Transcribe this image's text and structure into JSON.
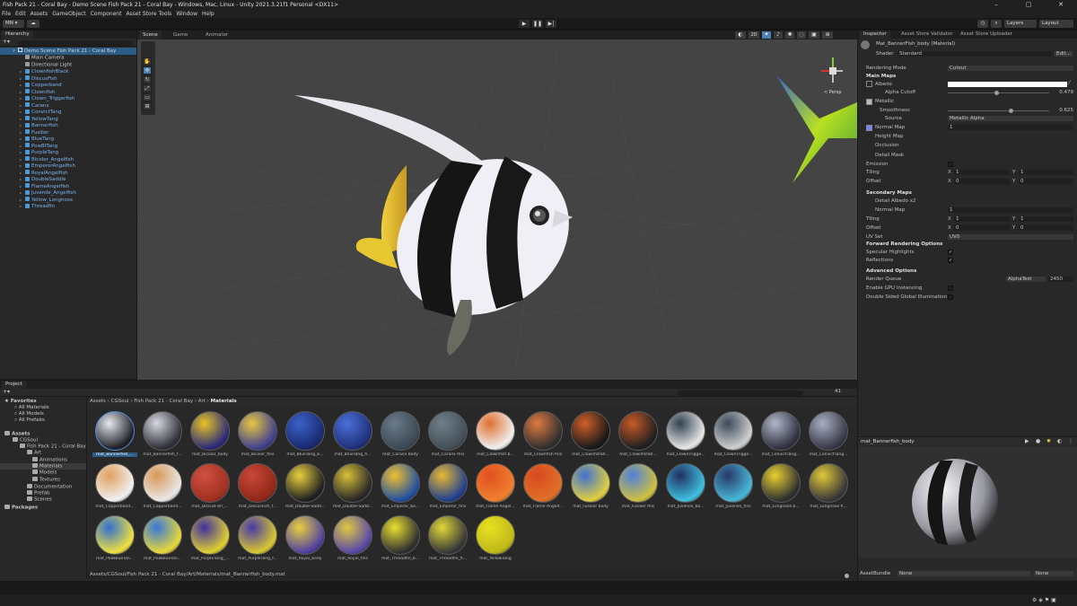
{
  "window": {
    "title": "Fish Pack 21 - Coral Bay - Demo Scene Fish Pack 21 - Coral Bay - Windows, Mac, Linux - Unity 2021.3.21f1 Personal <DX11>",
    "buttons": [
      "–",
      "▢",
      "✕"
    ]
  },
  "menu": [
    "File",
    "Edit",
    "Assets",
    "GameObject",
    "Component",
    "Asset Store Tools",
    "Window",
    "Help"
  ],
  "toolbar": {
    "account": "MN ▾",
    "layers": "Layers",
    "layout": "Layout"
  },
  "hierarchy": {
    "tab": "Hierarchy",
    "root": "Demo Scene Fish Pack 21 - Coral Bay",
    "items": [
      "Main Camera",
      "Directional Light",
      "ClownfishBlack",
      "DiscusFish",
      "Copperband",
      "Clownfish",
      "Clown_Triggerfish",
      "Caranx",
      "ConvictTang",
      "YellowTang",
      "Bannerfish",
      "Fusilier",
      "BlueTang",
      "PowBlTang",
      "PurpleTang",
      "Bicolor_Angelfish",
      "EmperorAngelfish",
      "RoyalAngelfish",
      "DoubleSaddle",
      "FlameAngelfish",
      "Juvenile_Angelfish",
      "Yellow_Longnose",
      "Threadfin"
    ]
  },
  "scene_tabs": [
    "Scene",
    "Game",
    "Animator"
  ],
  "scene_view": {
    "persp_label": "< Persp",
    "mode_2d": "2D"
  },
  "inspector": {
    "tabs": [
      "Inspector",
      "Asset Store Validator",
      "Asset Store Uploader"
    ],
    "material_name": "Mat_BannerFish_body (Material)",
    "shader_label": "Shader",
    "shader_value": "Standard",
    "edit_button": "Edit...",
    "rendering_mode_label": "Rendering Mode",
    "rendering_mode_value": "Cutout",
    "main_maps": "Main Maps",
    "albedo": "Albedo",
    "alpha_cutoff": "Alpha Cutoff",
    "alpha_cutoff_value": "0.479",
    "alpha_cutoff_level": 0.479,
    "metallic": "Metallic",
    "smoothness": "Smoothness",
    "smoothness_value": "0.625",
    "smoothness_level": 0.625,
    "source": "Source",
    "source_value": "Metallic Alpha",
    "normal_map": "Normal Map",
    "normal_map_value": "1",
    "height_map": "Height Map",
    "occlusion": "Occlusion",
    "detail_mask": "Detail Mask",
    "emission": "Emission",
    "tiling": "Tiling",
    "offset": "Offset",
    "tiling_x": "1",
    "tiling_y": "1",
    "offset_x": "0",
    "offset_y": "0",
    "secondary_maps": "Secondary Maps",
    "detail_albedo": "Detail Albedo x2",
    "normal_map2": "Normal Map",
    "normal_map2_value": "1",
    "tiling2_x": "1",
    "tiling2_y": "1",
    "offset2_x": "0",
    "offset2_y": "0",
    "uv_set": "UV Set",
    "uv_set_value": "UV0",
    "forward_options": "Forward Rendering Options",
    "specular_highlights": "Specular Highlights",
    "reflections": "Reflections",
    "advanced_options": "Advanced Options",
    "render_queue": "Render Queue",
    "render_queue_mode": "AlphaTest",
    "render_queue_value": "2450",
    "gpu_instancing": "Enable GPU Instancing",
    "double_sided_gi": "Double Sided Global Illumination",
    "preview_title": "mat_Bannerfish_body",
    "assetbundle_label": "AssetBundle",
    "assetbundle_value": "None",
    "assetbundle_variant": "None",
    "x_label": "X",
    "y_label": "Y"
  },
  "project": {
    "tab": "Project",
    "favorites": "Favorites",
    "fav_items": [
      "All Materials",
      "All Models",
      "All Prefabs"
    ],
    "assets": "Assets",
    "tree": [
      "CGSoul",
      "Fish Pack 21 - Coral Bay",
      "Art",
      "Animations",
      "Materials",
      "Models",
      "Textures",
      "Documentation",
      "Prefab",
      "Scenes"
    ],
    "packages": "Packages",
    "breadcrumb": [
      "Assets",
      "CGSoul",
      "Fish Pack 21 - Coral Bay",
      "Art",
      "Materials"
    ],
    "materials": [
      {
        "name": "mat_Bannerfish_...",
        "c1": "#e8e8f0",
        "c2": "#202028"
      },
      {
        "name": "mat_Bannerfish_f...",
        "c1": "#d8d8e0",
        "c2": "#303038"
      },
      {
        "name": "mat_Bicolor_body",
        "c1": "#e7c324",
        "c2": "#2a2a7a"
      },
      {
        "name": "mat_Bicolor_fins",
        "c1": "#e5c640",
        "c2": "#404090"
      },
      {
        "name": "mat_BlueTang_b...",
        "c1": "#3a62c8",
        "c2": "#1a2a70"
      },
      {
        "name": "mat_BlueTang_fi...",
        "c1": "#4a70d8",
        "c2": "#20307a"
      },
      {
        "name": "mat_Caranx body",
        "c1": "#6a7a88",
        "c2": "#3d4a55"
      },
      {
        "name": "mat_Caranx fins",
        "c1": "#707f8a",
        "c2": "#444f58"
      },
      {
        "name": "mat_Clownfish b...",
        "c1": "#e07030",
        "c2": "#f0f0f0"
      },
      {
        "name": "mat_Clownfish fins",
        "c1": "#e07a40",
        "c2": "#303030"
      },
      {
        "name": "mat_ClownfishBl...",
        "c1": "#d06028",
        "c2": "#181818"
      },
      {
        "name": "mat_ClownfishBl...",
        "c1": "#c85a28",
        "c2": "#202020"
      },
      {
        "name": "mat_ClownTrigge...",
        "c1": "#304050",
        "c2": "#e8e8e8"
      },
      {
        "name": "mat_ClownTrigge...",
        "c1": "#3a4a5a",
        "c2": "#d0d0d0"
      },
      {
        "name": "mat_ConvictTang...",
        "c1": "#b0b8c8",
        "c2": "#303040"
      },
      {
        "name": "mat_ConvictTang...",
        "c1": "#a8b0c0",
        "c2": "#383848"
      },
      {
        "name": "mat_Copperband...",
        "c1": "#e0a060",
        "c2": "#f0f0f0"
      },
      {
        "name": "mat_Copperband...",
        "c1": "#d89858",
        "c2": "#e8e8e8"
      },
      {
        "name": "mat_DiscusFish_...",
        "c1": "#d05040",
        "c2": "#a03020"
      },
      {
        "name": "mat_DiscusFish_f...",
        "c1": "#c84838",
        "c2": "#902818"
      },
      {
        "name": "mat_Double-Sadd...",
        "c1": "#e8d040",
        "c2": "#202020"
      },
      {
        "name": "mat_Double-Sadd...",
        "c1": "#d8c038",
        "c2": "#282828"
      },
      {
        "name": "mat_Emperor_bo...",
        "c1": "#f0c030",
        "c2": "#2050a0"
      },
      {
        "name": "mat_Emperor_fins",
        "c1": "#e8b830",
        "c2": "#204090"
      },
      {
        "name": "mat_Flame Angel...",
        "c1": "#e05020",
        "c2": "#f08030"
      },
      {
        "name": "mat_Flame Angelf...",
        "c1": "#d84a20",
        "c2": "#e07028"
      },
      {
        "name": "mat_Fusilier body",
        "c1": "#4070d0",
        "c2": "#e0d040"
      },
      {
        "name": "mat_Fusilier fins",
        "c1": "#5080d8",
        "c2": "#d0c040"
      },
      {
        "name": "mat_Juvenile_bo...",
        "c1": "#203060",
        "c2": "#40c0e0"
      },
      {
        "name": "mat_Juvenile_fins",
        "c1": "#283868",
        "c2": "#48b8d8"
      },
      {
        "name": "mat_Longnose b...",
        "c1": "#e8d030",
        "c2": "#303030"
      },
      {
        "name": "mat_Longnose fi...",
        "c1": "#e0c838",
        "c2": "#383838"
      },
      {
        "name": "mat_PowBlueTan...",
        "c1": "#3070d0",
        "c2": "#f0e040"
      },
      {
        "name": "mat_PowBlueTan...",
        "c1": "#3878d8",
        "c2": "#e8d838"
      },
      {
        "name": "mat_PurpleTang_...",
        "c1": "#4030a0",
        "c2": "#e0d030"
      },
      {
        "name": "mat_PurpleTang_f...",
        "c1": "#4838a8",
        "c2": "#d8c830"
      },
      {
        "name": "mat_Royal_body",
        "c1": "#e8d040",
        "c2": "#5040a0"
      },
      {
        "name": "mat_Royal_fins",
        "c1": "#e0c840",
        "c2": "#5848a8"
      },
      {
        "name": "mat_Threadfin_b...",
        "c1": "#e8e030",
        "c2": "#303030"
      },
      {
        "name": "mat_Threadfin_fi...",
        "c1": "#e0d838",
        "c2": "#383838"
      },
      {
        "name": "mat_YellowTang",
        "c1": "#e8e020",
        "c2": "#c0b818"
      }
    ],
    "path": "Assets/CGSoul/Fish Pack 21 - Coral Bay/Art/Materials/mat_Bannerfish_body.mat",
    "count": "41"
  }
}
